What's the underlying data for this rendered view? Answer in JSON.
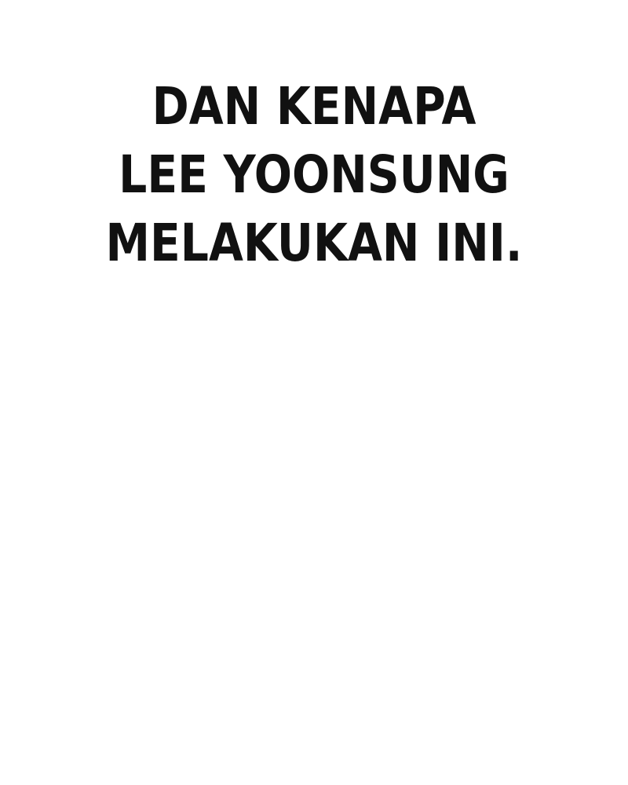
{
  "caption": {
    "lines": [
      "DAN KENAPA",
      "LEE YOONSUNG",
      "MELAKUKAN INI."
    ]
  },
  "colors": {
    "background": "#ffffff",
    "text": "#111111"
  }
}
